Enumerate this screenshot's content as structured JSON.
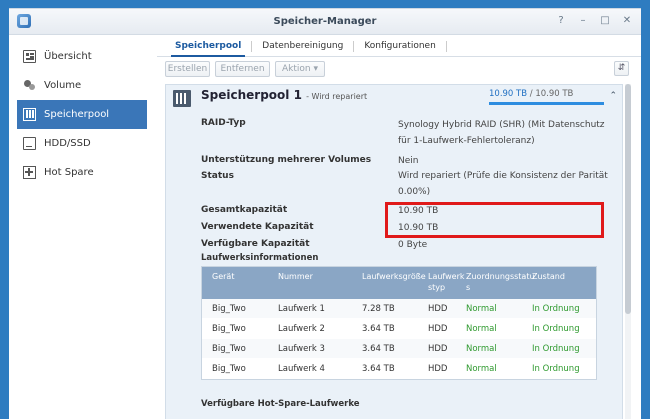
{
  "window": {
    "title": "Speicher-Manager",
    "help": "?",
    "minimize": "–",
    "maximize": "□",
    "close": "✕"
  },
  "sidebar": {
    "items": [
      {
        "label": "Übersicht",
        "icon": "overview-icon"
      },
      {
        "label": "Volume",
        "icon": "volume-icon"
      },
      {
        "label": "Speicherpool",
        "icon": "storage-pool-icon",
        "active": true
      },
      {
        "label": "HDD/SSD",
        "icon": "hdd-icon"
      },
      {
        "label": "Hot Spare",
        "icon": "hot-spare-icon"
      }
    ]
  },
  "tabs": [
    {
      "label": "Speicherpool",
      "active": true
    },
    {
      "label": "Datenbereinigung"
    },
    {
      "label": "Konfigurationen"
    }
  ],
  "toolbar": {
    "create": "Erstellen",
    "remove": "Entfernen",
    "action": "Aktion ▾",
    "sort": "⇵"
  },
  "pool": {
    "title": "Speicherpool 1",
    "subtitle": "- Wird repariert",
    "capacity_used": "10.90 TB",
    "capacity_total": "/ 10.90 TB",
    "capacity_fraction": 1.0,
    "collapse": "⌃",
    "properties": [
      {
        "label": "RAID-Typ",
        "value": "Synology Hybrid RAID (SHR) (Mit Datenschutz für 1-Laufwerk-Fehlertoleranz)"
      },
      {
        "label": "Unterstützung mehrerer Volumes",
        "value": "Nein"
      },
      {
        "label": "Status",
        "value": "Wird repariert (Prüfe die Konsistenz der Parität 0.00%)"
      },
      {
        "label": "Gesamtkapazität",
        "value": "10.90 TB"
      },
      {
        "label": "Verwendete Kapazität",
        "value": "10.90 TB"
      },
      {
        "label": "Verfügbare Kapazität",
        "value": "0 Byte"
      }
    ],
    "drives_title": "Laufwerksinformationen",
    "drive_columns": [
      "Gerät",
      "Nummer",
      "Laufwerksgröße",
      "Laufwerk styp",
      "ZuordnungsstatuZustand s",
      ""
    ],
    "drive_columns_split": {
      "device": "Gerät",
      "number": "Nummer",
      "size": "Laufwerksgröße",
      "type1": "Laufwerk",
      "type2": "styp",
      "assign1": "Zuordnungsstatu",
      "assign2": "s",
      "state": "Zustand"
    },
    "drives": [
      {
        "device": "Big_Two",
        "number": "Laufwerk 1",
        "size": "7.28 TB",
        "type": "HDD",
        "assignment": "Normal",
        "state": "In Ordnung"
      },
      {
        "device": "Big_Two",
        "number": "Laufwerk 2",
        "size": "3.64 TB",
        "type": "HDD",
        "assignment": "Normal",
        "state": "In Ordnung"
      },
      {
        "device": "Big_Two",
        "number": "Laufwerk 3",
        "size": "3.64 TB",
        "type": "HDD",
        "assignment": "Normal",
        "state": "In Ordnung"
      },
      {
        "device": "Big_Two",
        "number": "Laufwerk 4",
        "size": "3.64 TB",
        "type": "HDD",
        "assignment": "Normal",
        "state": "In Ordnung"
      }
    ],
    "hotspare_title": "Verfügbare Hot-Spare-Laufwerke"
  },
  "colors": {
    "accent": "#3a76b8",
    "highlight_box": "#e01a1a",
    "ok_green": "#2f9a2f",
    "table_header": "#8aa6c5"
  }
}
